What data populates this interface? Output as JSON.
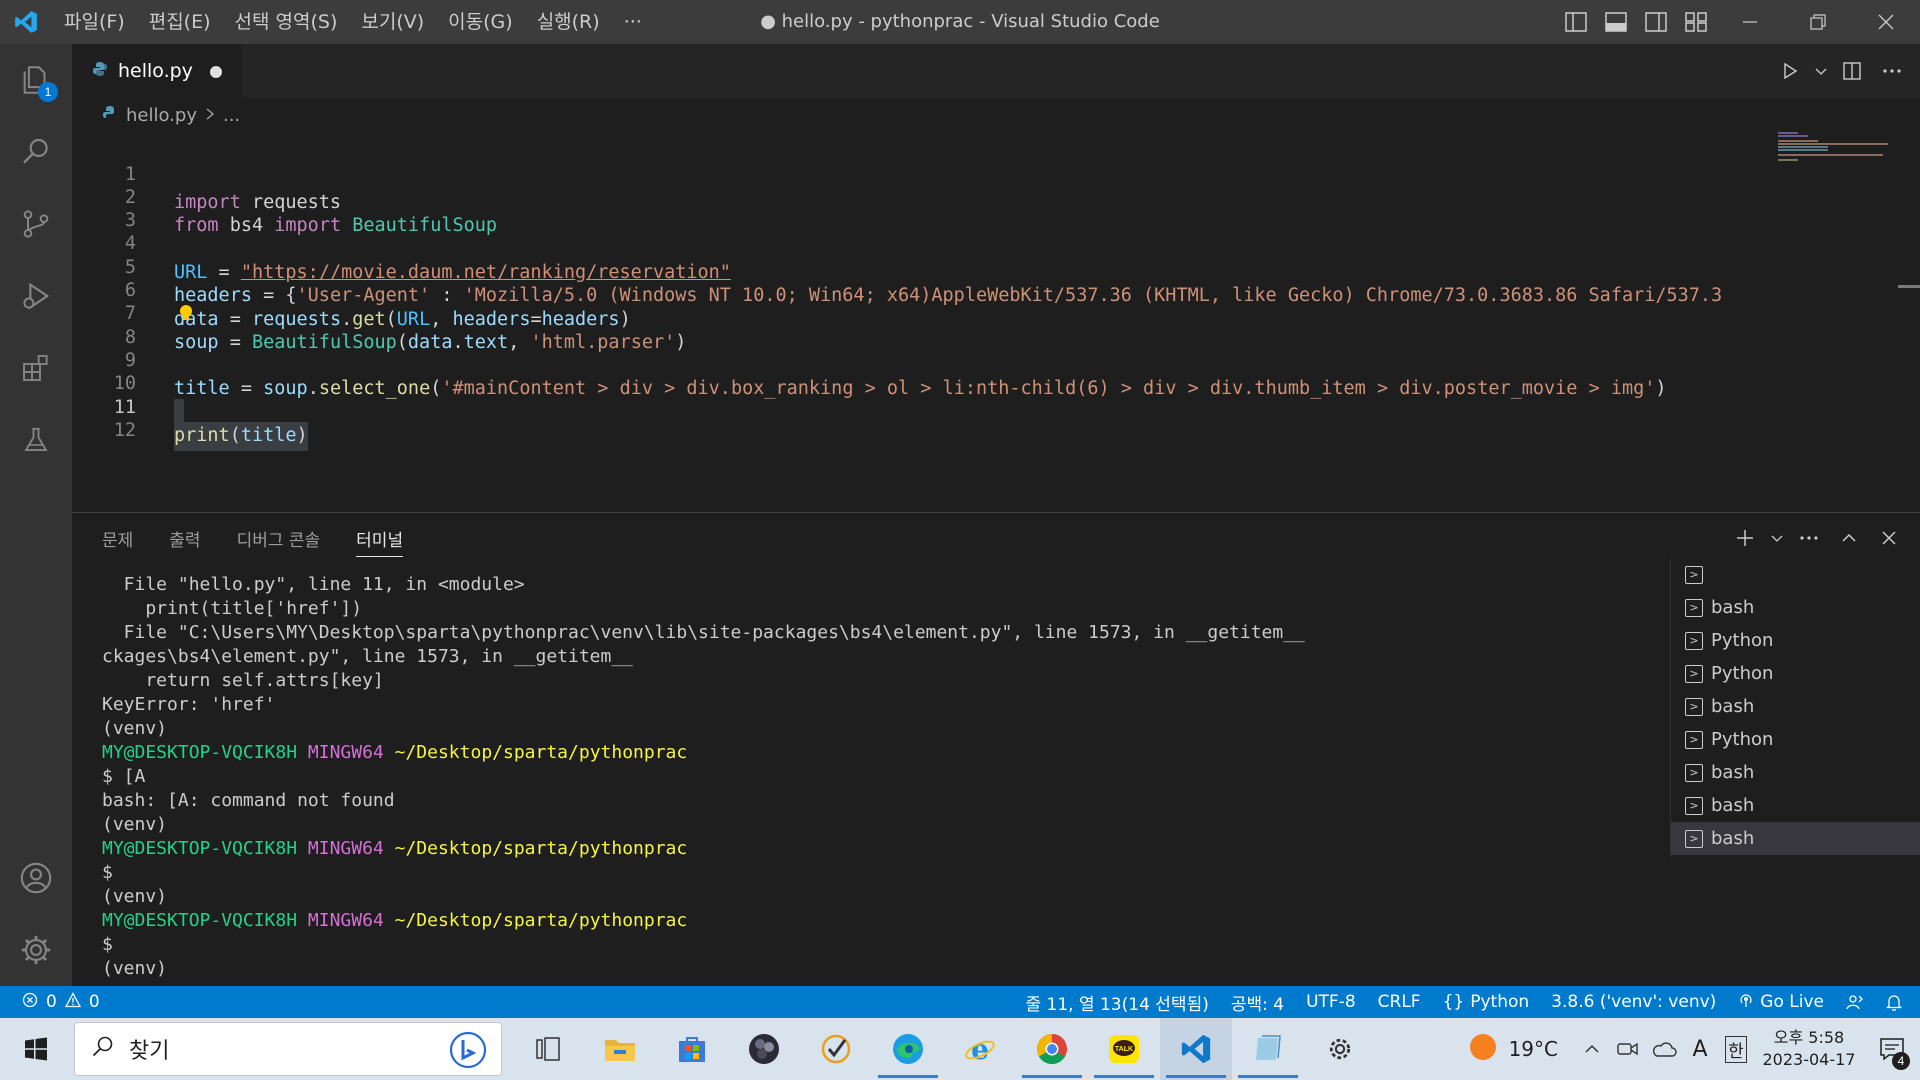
{
  "window": {
    "title": "● hello.py - pythonprac - Visual Studio Code",
    "menu": [
      "파일(F)",
      "편집(E)",
      "선택 영역(S)",
      "보기(V)",
      "이동(G)",
      "실행(R)",
      "···"
    ]
  },
  "activity": {
    "explorer_badge": "1"
  },
  "editor": {
    "tab_label": "hello.py",
    "breadcrumb_file": "hello.py",
    "breadcrumb_rest": "...",
    "line_numbers": [
      "1",
      "2",
      "3",
      "4",
      "5",
      "6",
      "7",
      "8",
      "9",
      "10",
      "11",
      "12"
    ],
    "code": {
      "l1": [
        "import",
        " requests"
      ],
      "l2": [
        "from",
        " bs4 ",
        "import",
        " BeautifulSoup"
      ],
      "l4": [
        "URL",
        " = ",
        "\"https://movie.daum.net/ranking/reservation\""
      ],
      "l5": [
        "headers",
        " = {",
        "'User-Agent'",
        " : ",
        "'Mozilla/5.0 (Windows NT 10.0; Win64; x64)AppleWebKit/537.36 (KHTML, like Gecko) Chrome/73.0.3683.86 Safari/537.3"
      ],
      "l6": [
        "data",
        " = ",
        "requests",
        ".",
        "get",
        "(",
        "URL",
        ", ",
        "headers",
        "=",
        "headers",
        ")"
      ],
      "l7": [
        "soup",
        " = ",
        "BeautifulSoup",
        "(",
        "data",
        ".",
        "text",
        ", ",
        "'html.parser'",
        ")"
      ],
      "l9": [
        "title",
        " = ",
        "soup",
        ".",
        "select_one",
        "(",
        "'#mainContent > div > div.box_ranking > ol > li:nth-child(6) > div > div.thumb_item > div.poster_movie > img'",
        ")"
      ],
      "l11": [
        "print",
        "(",
        "title",
        ")"
      ]
    }
  },
  "panel": {
    "tabs": [
      "문제",
      "출력",
      "디버그 콘솔",
      "터미널"
    ],
    "terminal_lines": [
      "  File \"hello.py\", line 11, in <module>",
      "    print(title['href'])",
      "  File \"C:\\Users\\MY\\Desktop\\sparta\\pythonprac\\venv\\lib\\site-packages\\bs4\\element.py\", line 1573, in __getitem__",
      "ckages\\bs4\\element.py\", line 1573, in __getitem__",
      "    return self.attrs[key]",
      "KeyError: 'href'",
      "(venv)"
    ],
    "prompt_user": "MY@DESKTOP-VQCIK8H",
    "prompt_env": "MINGW64",
    "prompt_path": "~/Desktop/sparta/pythonprac",
    "cmd1": "$ [A",
    "cmd1_out": "bash: [A: command not found",
    "venv": "(venv)",
    "cmd2": "$",
    "cmd3": "$",
    "terminals": [
      "",
      "bash",
      "Python",
      "Python",
      "bash",
      "Python",
      "bash",
      "bash",
      "bash"
    ]
  },
  "status": {
    "errors": "0",
    "warnings": "0",
    "position": "줄 11, 열 13(14 선택됨)",
    "spaces": "공백: 4",
    "encoding": "UTF-8",
    "eol": "CRLF",
    "language": "Python",
    "interpreter": "3.8.6 ('venv': venv)",
    "golive": "Go Live"
  },
  "taskbar": {
    "search_placeholder": "찾기",
    "temperature": "19°C",
    "ime_a": "A",
    "ime_han": "한",
    "clock_time": "오후 5:58",
    "clock_date": "2023-04-17",
    "notif_count": "4"
  },
  "colors": {
    "accent": "#007acc",
    "titlebar": "#3c3c3c",
    "activitybar": "#333333",
    "editor_bg": "#1e1e1e"
  }
}
